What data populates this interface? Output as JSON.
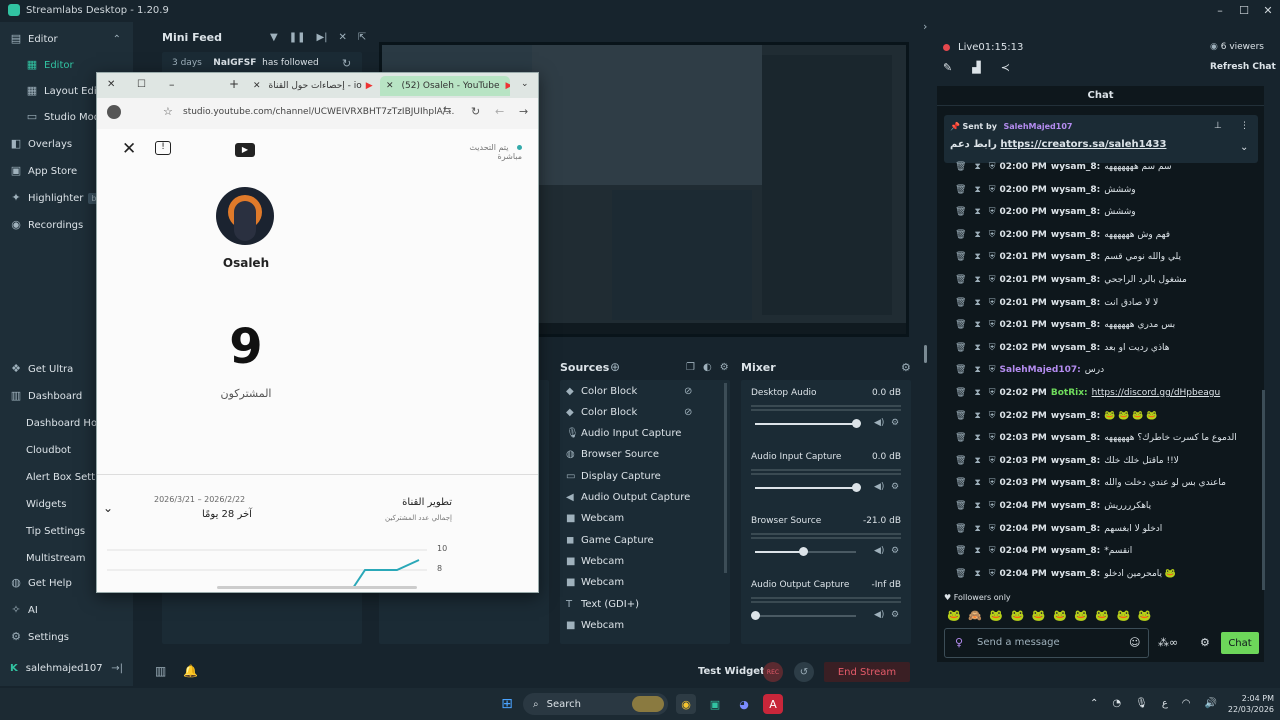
{
  "app": {
    "title": "Streamlabs Desktop - 1.20.9"
  },
  "window_controls": [
    "–",
    "☐",
    "✕"
  ],
  "sidebar": {
    "top": [
      {
        "label": "Editor",
        "icon": "layout-icon",
        "chev": "⌃"
      },
      {
        "label": "Editor",
        "icon": "editor-icon"
      },
      {
        "label": "Layout Editor",
        "icon": "grid-icon"
      },
      {
        "label": "Studio Mode",
        "icon": "studio-icon"
      },
      {
        "label": "Overlays",
        "icon": "overlays-icon"
      },
      {
        "label": "App Store",
        "icon": "store-icon"
      },
      {
        "label": "Highlighter",
        "icon": "highlighter-icon",
        "badge": "beta"
      },
      {
        "label": "Recordings",
        "icon": "record-icon"
      }
    ],
    "bottom": [
      {
        "label": "Get Ultra",
        "icon": "ultra-icon"
      },
      {
        "label": "Dashboard",
        "icon": "dashboard-icon"
      },
      {
        "label": "Dashboard Home"
      },
      {
        "label": "Cloudbot"
      },
      {
        "label": "Alert Box Settings"
      },
      {
        "label": "Widgets"
      },
      {
        "label": "Tip Settings"
      },
      {
        "label": "Multistream"
      },
      {
        "label": "Get Help",
        "icon": "help-icon"
      },
      {
        "label": "AI",
        "icon": "ai-icon"
      },
      {
        "label": "Settings",
        "icon": "settings-icon"
      }
    ],
    "user": "salehmajed107"
  },
  "minifeed": {
    "title": "Mini Feed",
    "event": {
      "age": "3 days",
      "user": "NaIGFSF",
      "action": "has followed"
    }
  },
  "youtube_window": {
    "tabs": [
      {
        "label": "إحصاءات حول القناة - io"
      },
      {
        "label": "(52) Osaleh - YouTube"
      }
    ],
    "url": "studio.youtube.com/channel/UCWEIVRXBHT7zTzIBJUIhplA/...",
    "update_label": "يتم التحديث",
    "live_label": "مباشرة",
    "channel_name": "Osaleh",
    "subscriber_count": "9",
    "subscribers_label": "المشتركون",
    "growth_title": "تطوير القناة",
    "growth_subtitle": "إجمالي عدد المشتركين",
    "date_range": "2026/3/21 – 2026/2/22",
    "period": "آخر 28 يومًا",
    "ticks": [
      "10",
      "8"
    ]
  },
  "sources": {
    "title": "Sources",
    "items": [
      {
        "label": "Color Block",
        "icon": "color-block-icon"
      },
      {
        "label": "Color Block",
        "icon": "color-block-icon"
      },
      {
        "label": "Audio Input Capture",
        "icon": "mic-icon"
      },
      {
        "label": "Browser Source",
        "icon": "globe-icon"
      },
      {
        "label": "Display Capture",
        "icon": "monitor-icon"
      },
      {
        "label": "Audio Output Capture",
        "icon": "speaker-icon"
      },
      {
        "label": "Webcam",
        "icon": "camera-icon"
      },
      {
        "label": "Game Capture",
        "icon": "gamepad-icon"
      },
      {
        "label": "Webcam",
        "icon": "camera-icon"
      },
      {
        "label": "Webcam",
        "icon": "camera-icon"
      },
      {
        "label": "Text (GDI+)",
        "icon": "text-icon"
      },
      {
        "label": "Webcam",
        "icon": "camera-icon"
      }
    ]
  },
  "mixer": {
    "title": "Mixer",
    "tracks": [
      {
        "name": "Desktop Audio",
        "db": "0.0 dB",
        "level": 1.0
      },
      {
        "name": "Audio Input Capture",
        "db": "0.0 dB",
        "level": 1.0
      },
      {
        "name": "Browser Source",
        "db": "-21.0 dB",
        "level": 0.48
      },
      {
        "name": "Audio Output Capture",
        "db": "-Inf dB",
        "level": 0.0
      }
    ]
  },
  "bottom": {
    "test_widgets": "Test Widgets",
    "rec": "REC",
    "end_stream": "End Stream"
  },
  "live": {
    "status": "Live",
    "time": "01:15:13",
    "viewers": "6 viewers",
    "refresh": "Refresh Chat"
  },
  "chat": {
    "title": "Chat",
    "pinned": {
      "sent_by": "Sent by",
      "user": "SalehMajed107",
      "text": "رابط دعم",
      "link": "https://creators.sa/saleh1433"
    },
    "messages": [
      {
        "time": "02:00 PM",
        "user": "wysam_8:",
        "text": "سم سم هههههههه"
      },
      {
        "time": "02:00 PM",
        "user": "wysam_8:",
        "text": "وششش"
      },
      {
        "time": "02:00 PM",
        "user": "wysam_8:",
        "text": "وششش"
      },
      {
        "time": "02:00 PM",
        "user": "wysam_8:",
        "text": "فهم وش ههههههه"
      },
      {
        "time": "02:01 PM",
        "user": "wysam_8:",
        "text": "يلي والله نومي قسم"
      },
      {
        "time": "02:01 PM",
        "user": "wysam_8:",
        "text": "مشغول بالرد الراجحي"
      },
      {
        "time": "02:01 PM",
        "user": "wysam_8:",
        "text": "لا لا صادق انت"
      },
      {
        "time": "02:01 PM",
        "user": "wysam_8:",
        "text": "بس مدري ههههههه"
      },
      {
        "time": "02:02 PM",
        "user": "wysam_8:",
        "text": "هاذي رديت او بعد"
      },
      {
        "time": "",
        "user": "SalehMajed107:",
        "text": "درس",
        "color": "purple"
      },
      {
        "time": "02:02 PM",
        "user": "BotRix:",
        "text": "",
        "link": "https://discord.gg/dHpbeagu",
        "color": "green"
      },
      {
        "time": "02:02 PM",
        "user": "wysam_8:",
        "text": "🐸 🐸 🐸 🐸"
      },
      {
        "time": "02:03 PM",
        "user": "wysam_8:",
        "text": "الدموع ما كسرت خاطرك؟ ههههههه"
      },
      {
        "time": "02:03 PM",
        "user": "wysam_8:",
        "text": "لا!! ماقتل خلك خلك"
      },
      {
        "time": "02:03 PM",
        "user": "wysam_8:",
        "text": "ماعندي بس لو عندي دخلت والله"
      },
      {
        "time": "02:04 PM",
        "user": "wysam_8:",
        "text": "ياهكرررريش"
      },
      {
        "time": "02:04 PM",
        "user": "wysam_8:",
        "text": "ادخلو لا ابغسهم"
      },
      {
        "time": "02:04 PM",
        "user": "wysam_8:",
        "text": "*انقسم"
      },
      {
        "time": "02:04 PM",
        "user": "wysam_8:",
        "text": "يامحرمين ادخلو 🐸"
      }
    ],
    "followers_only": "Followers only",
    "emotes": "🐸 🙈 🐸 🐸 🐸 🐸 🐸 🐸 🐸 🐸",
    "input_placeholder": "Send a message",
    "send_label": "Chat"
  },
  "taskbar": {
    "search": "Search",
    "time": "2:04 PM",
    "date": "22/03/2026",
    "lang": "ع"
  },
  "colors": {
    "accent": "#31c3a2",
    "live_red": "#e5484d",
    "chat_button": "#80f5d2"
  }
}
